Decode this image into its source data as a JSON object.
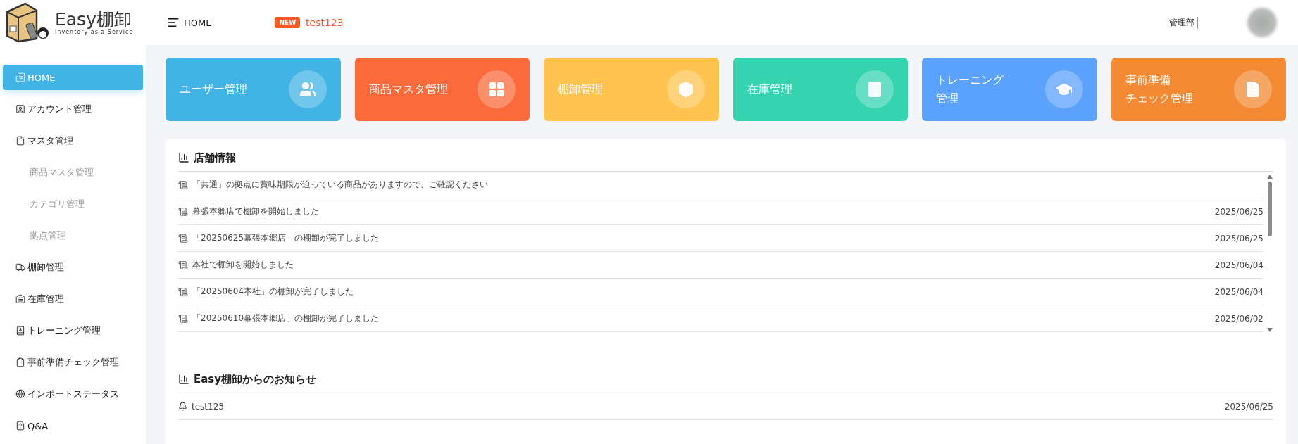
{
  "logo": {
    "name": "Easy棚卸",
    "tagline": "Inventory as a Service"
  },
  "header": {
    "menu_label": "HOME",
    "badge": "NEW",
    "notice": "test123",
    "department": "管理部"
  },
  "sidebar": {
    "items": [
      {
        "label": "HOME",
        "selected": true
      },
      {
        "label": "アカウント管理",
        "selected": false
      },
      {
        "label": "マスタ管理",
        "selected": false,
        "children": [
          {
            "label": "商品マスタ管理",
            "selected": false
          },
          {
            "label": "カテゴリ管理",
            "selected": false
          },
          {
            "label": "拠点管理",
            "selected": false
          }
        ]
      },
      {
        "label": "棚卸管理",
        "selected": false
      },
      {
        "label": "在庫管理",
        "selected": false
      },
      {
        "label": "トレーニング管理",
        "selected": false
      },
      {
        "label": "事前準備チェック管理",
        "selected": false
      },
      {
        "label": "インポートステータス",
        "selected": false
      },
      {
        "label": "Q&A",
        "selected": false
      }
    ]
  },
  "cards": [
    {
      "lines": [
        "ユーザー管理"
      ],
      "color": "#41b3e5"
    },
    {
      "lines": [
        "商品マスタ管理"
      ],
      "color": "#fb6a3a"
    },
    {
      "lines": [
        "棚卸管理"
      ],
      "color": "#fec44f"
    },
    {
      "lines": [
        "在庫管理"
      ],
      "color": "#36d3b0"
    },
    {
      "lines": [
        "トレーニング",
        "管理"
      ],
      "color": "#5aa2fb"
    },
    {
      "lines": [
        "事前準備",
        "チェック管理"
      ],
      "color": "#f38a33"
    }
  ],
  "store_info": {
    "title": "店舗情報",
    "items": [
      {
        "text": "「共通」の拠点に賞味期限が迫っている商品がありますので、ご確認ください"
      },
      {
        "text": "幕張本郷店で棚卸を開始しました",
        "date": "2025/06/25"
      },
      {
        "text": "「20250625幕張本郷店」の棚卸が完了しました",
        "date": "2025/06/25"
      },
      {
        "text": "本社で棚卸を開始しました",
        "date": "2025/06/04"
      },
      {
        "text": "「20250604本社」の棚卸が完了しました",
        "date": "2025/06/04"
      },
      {
        "text": "「20250610幕張本郷店」の棚卸が完了しました",
        "date": "2025/06/02"
      }
    ]
  },
  "announcements": {
    "title": "Easy棚卸からのお知らせ",
    "items": [
      {
        "text": "test123",
        "date": "2025/06/25"
      }
    ]
  }
}
